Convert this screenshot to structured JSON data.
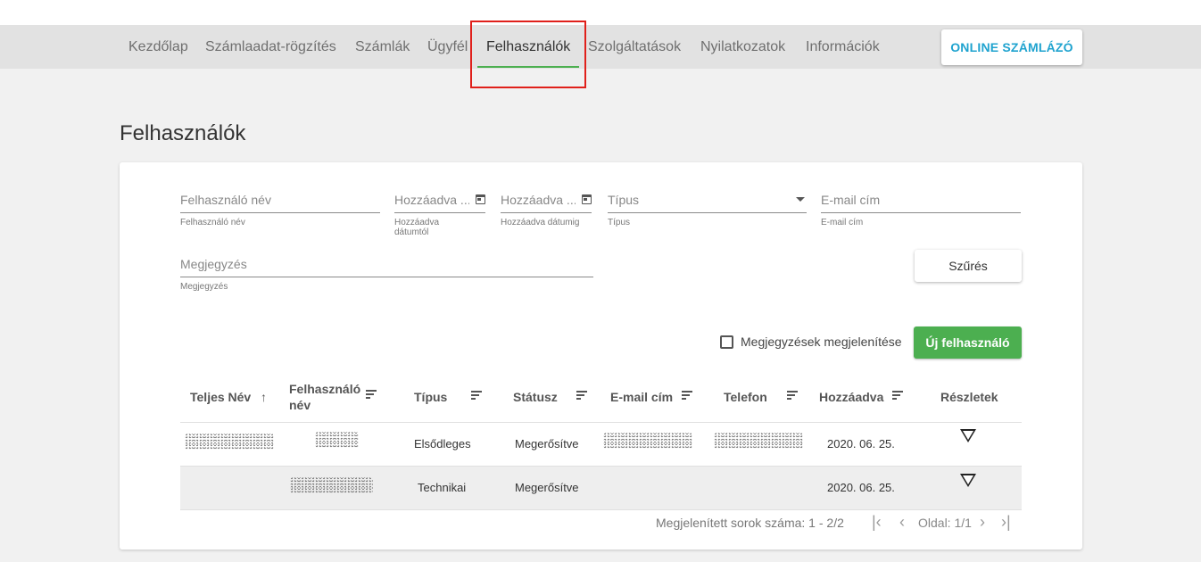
{
  "nav": {
    "items": [
      {
        "label": "Kezdőlap"
      },
      {
        "label": "Számlaadat-rögzítés"
      },
      {
        "label": "Számlák"
      },
      {
        "label": "Ügyfél"
      },
      {
        "label": "Felhasználók",
        "active": true
      },
      {
        "label": "Szolgáltatások"
      },
      {
        "label": "Nyilatkozatok"
      },
      {
        "label": "Információk"
      }
    ],
    "online_button": "ONLINE SZÁMLÁZÓ",
    "accent_color": "#4caf50",
    "highlight_color": "#e0201b"
  },
  "page": {
    "title": "Felhasználók"
  },
  "filters": {
    "username": {
      "placeholder": "Felhasználó név",
      "hint": "Felhasználó név"
    },
    "date_from": {
      "placeholder": "Hozzáadva ...",
      "hint": "Hozzáadva dátumtól"
    },
    "date_to": {
      "placeholder": "Hozzáadva ...",
      "hint": "Hozzáadva dátumig"
    },
    "type": {
      "placeholder": "Típus",
      "hint": "Típus"
    },
    "email": {
      "placeholder": "E-mail cím",
      "hint": "E-mail cím"
    },
    "note": {
      "placeholder": "Megjegyzés",
      "hint": "Megjegyzés"
    },
    "filter_button": "Szűrés"
  },
  "actions": {
    "show_notes_label": "Megjegyzések megjelenítése",
    "show_notes_checked": false,
    "new_user_button": "Új felhasználó",
    "new_user_color": "#4caf50"
  },
  "table": {
    "columns": {
      "full_name": "Teljes Név",
      "username_1": "Felhasználó",
      "username_2": "név",
      "type": "Típus",
      "status": "Státusz",
      "email": "E-mail cím",
      "phone": "Telefon",
      "added": "Hozzáadva",
      "details": "Részletek"
    },
    "rows": [
      {
        "type": "Elsődleges",
        "status": "Megerősítve",
        "added": "2020. 06. 25."
      },
      {
        "type": "Technikai",
        "status": "Megerősítve",
        "added": "2020. 06. 25."
      }
    ]
  },
  "pager": {
    "rows_text": "Megjelenített sorok száma: 1 - 2/2",
    "page_text": "Oldal: 1/1"
  }
}
